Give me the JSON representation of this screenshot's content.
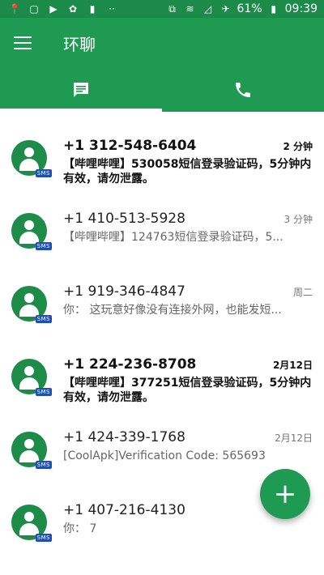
{
  "status": {
    "battery": "61%",
    "time": "09:39",
    "icons": [
      "pin-icon",
      "app-icon",
      "youtube-icon",
      "leaf-icon",
      "battery-saver-icon",
      "more-icon",
      "cast-icon",
      "wifi-icon",
      "signal-icon",
      "airplane-icon",
      "battery-icon"
    ]
  },
  "toolbar": {
    "title": "环聊"
  },
  "tabs": [
    "message-tab",
    "phone-tab"
  ],
  "conversations": [
    {
      "name": "+1 312-548-6404",
      "time": "2 分钟",
      "preview": "【哔哩哔哩】530058短信登录验证码，5分钟内有效，请勿泄露。",
      "unread": true
    },
    {
      "name": "+1 410-513-5928",
      "time": "3 分钟",
      "preview": "【哔哩哔哩】124763短信登录验证码，5...",
      "unread": false
    },
    {
      "name": "+1 919-346-4847",
      "time": "周二",
      "preview": "你： 这玩意好像没有连接外网，也能发短...",
      "unread": false
    },
    {
      "name": "+1 224-236-8708",
      "time": "2月12日",
      "preview": "【哔哩哔哩】377251短信登录验证码，5分钟内有效，请勿泄露。",
      "unread": true
    },
    {
      "name": "+1 424-339-1768",
      "time": "2月12日",
      "preview": "[CoolApk]Verification Code: 565693",
      "unread": false
    },
    {
      "name": "+1 407-216-4130",
      "time": "",
      "preview": "你： 7",
      "unread": false
    }
  ],
  "sms_badge": "SMS",
  "fab_label": "+"
}
